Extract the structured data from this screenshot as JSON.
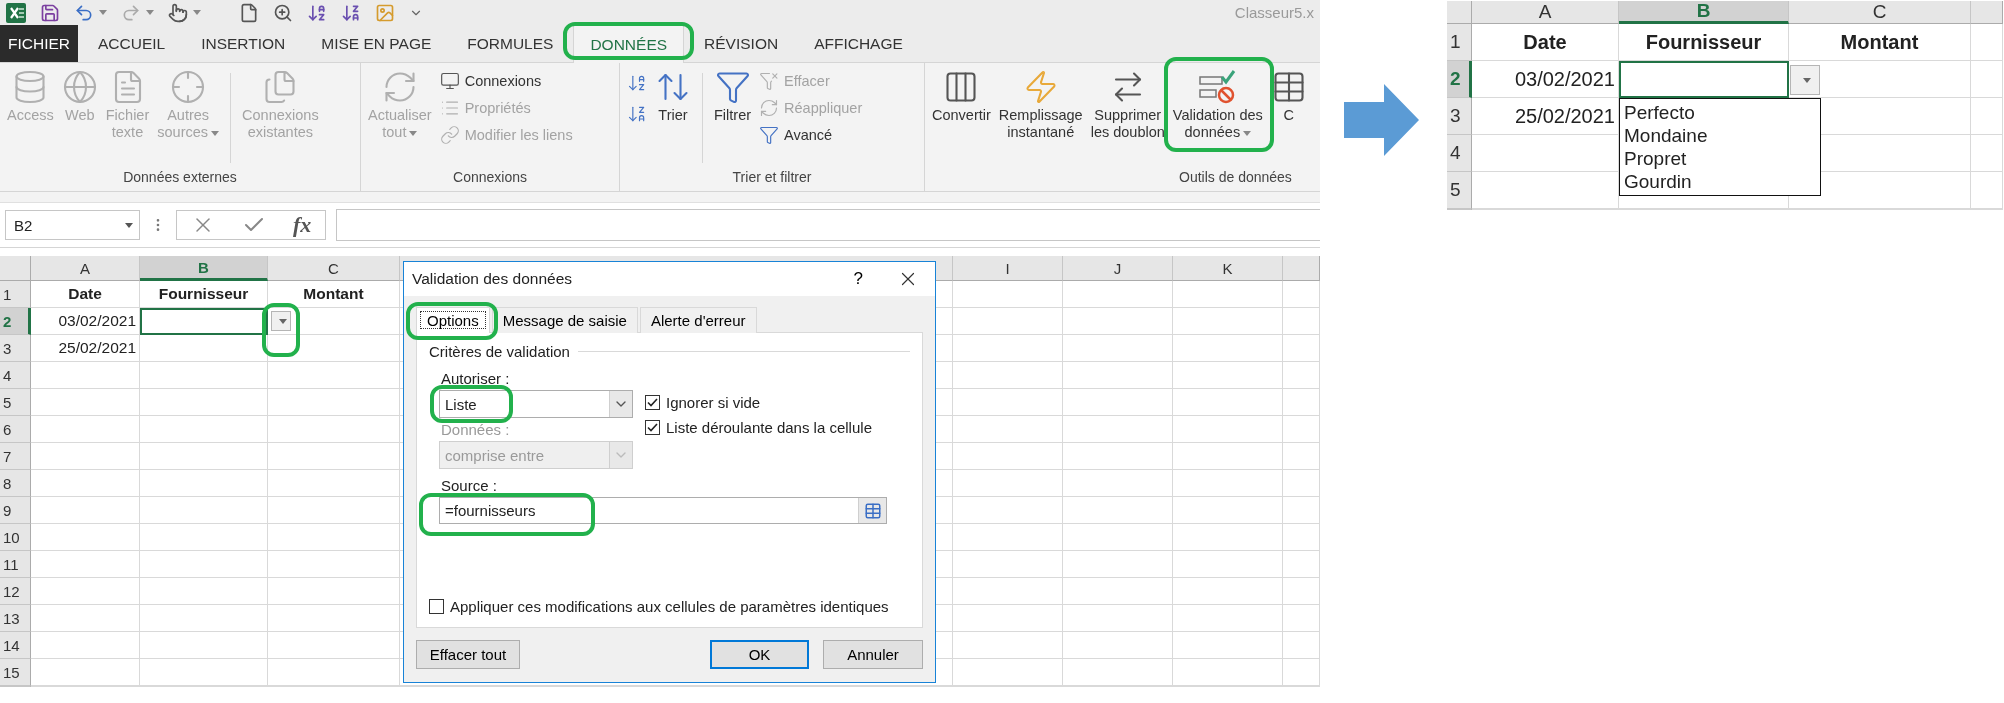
{
  "window": {
    "title": "Classeur5.x"
  },
  "tabs": [
    {
      "label": "FICHIER",
      "kind": "file",
      "selected": false,
      "annotated": false
    },
    {
      "label": "ACCUEIL",
      "kind": "tab",
      "selected": false,
      "annotated": false
    },
    {
      "label": "INSERTION",
      "kind": "tab",
      "selected": false,
      "annotated": false
    },
    {
      "label": "MISE EN PAGE",
      "kind": "tab",
      "selected": false,
      "annotated": false
    },
    {
      "label": "FORMULES",
      "kind": "tab",
      "selected": false,
      "annotated": false
    },
    {
      "label": "DONNÉES",
      "kind": "tab",
      "selected": true,
      "annotated": true
    },
    {
      "label": "RÉVISION",
      "kind": "tab",
      "selected": false,
      "annotated": false
    },
    {
      "label": "AFFICHAGE",
      "kind": "tab",
      "selected": false,
      "annotated": false
    }
  ],
  "ribbon": {
    "groups": [
      {
        "label": "Données externes",
        "items": [
          {
            "kind": "large",
            "label": "Access",
            "disabled": true,
            "dropdown": false
          },
          {
            "kind": "large",
            "label": "Web",
            "disabled": true,
            "dropdown": false
          },
          {
            "kind": "large",
            "label": "Fichier\ntexte",
            "disabled": true,
            "dropdown": false
          },
          {
            "kind": "large",
            "label": "Autres\nsources",
            "disabled": true,
            "dropdown": true
          },
          {
            "kind": "separator"
          },
          {
            "kind": "large",
            "label": "Connexions\nexistantes",
            "disabled": true,
            "dropdown": false
          }
        ]
      },
      {
        "label": "Connexions",
        "items": [
          {
            "kind": "large",
            "label": "Actualiser\ntout",
            "disabled": true,
            "dropdown": true
          },
          {
            "kind": "stack",
            "items": [
              {
                "kind": "small",
                "label": "Connexions",
                "disabled": false
              },
              {
                "kind": "small",
                "label": "Propriétés",
                "disabled": true
              },
              {
                "kind": "small",
                "label": "Modifier les liens",
                "disabled": true
              }
            ]
          }
        ]
      },
      {
        "label": "Trier et filtrer",
        "items": [
          {
            "kind": "stack",
            "items": [
              {
                "kind": "icon",
                "disabled": false
              },
              {
                "kind": "icon",
                "disabled": false
              }
            ]
          },
          {
            "kind": "large",
            "label": "Trier",
            "disabled": false,
            "dropdown": false
          },
          {
            "kind": "separator"
          },
          {
            "kind": "large",
            "label": "Filtrer",
            "disabled": false,
            "dropdown": false
          },
          {
            "kind": "stack",
            "items": [
              {
                "kind": "small",
                "label": "Effacer",
                "disabled": true
              },
              {
                "kind": "small",
                "label": "Réappliquer",
                "disabled": true
              },
              {
                "kind": "small",
                "label": "Avancé",
                "disabled": false
              }
            ]
          }
        ]
      },
      {
        "label": "Outils de données",
        "items": [
          {
            "kind": "large",
            "label": "Convertir",
            "disabled": false,
            "dropdown": false
          },
          {
            "kind": "large",
            "label": "Remplissage\ninstantané",
            "disabled": false,
            "dropdown": false
          },
          {
            "kind": "large",
            "label": "Supprimer\nles doublon",
            "disabled": false,
            "dropdown": false
          },
          {
            "kind": "large",
            "label": "Validation des\ndonnées",
            "disabled": false,
            "dropdown": true,
            "annotated": true
          },
          {
            "kind": "large",
            "label": "C",
            "disabled": false,
            "dropdown": false
          }
        ]
      }
    ]
  },
  "formula_bar": {
    "name_box": "B2",
    "function_label": "fx"
  },
  "sheet": {
    "columns": [
      {
        "label": "A",
        "selected": false
      },
      {
        "label": "B",
        "selected": true
      },
      {
        "label": "C",
        "selected": false
      },
      {
        "label": "I",
        "selected": false
      },
      {
        "label": "J",
        "selected": false
      },
      {
        "label": "K",
        "selected": false
      }
    ],
    "rows": [
      {
        "number": "1",
        "kind": "header",
        "selected": false,
        "cells": [
          "Date",
          "Fournisseur",
          "Montant"
        ]
      },
      {
        "number": "2",
        "kind": "data",
        "selected": true,
        "cells": [
          "03/02/2021"
        ]
      },
      {
        "number": "3",
        "kind": "data",
        "selected": false,
        "cells": [
          "25/02/2021"
        ]
      },
      {
        "number": "4",
        "kind": "data",
        "selected": false
      },
      {
        "number": "5",
        "kind": "data",
        "selected": false
      },
      {
        "number": "6",
        "kind": "data",
        "selected": false
      },
      {
        "number": "7",
        "kind": "data",
        "selected": false
      },
      {
        "number": "8",
        "kind": "data",
        "selected": false
      },
      {
        "number": "9",
        "kind": "data",
        "selected": false
      },
      {
        "number": "10",
        "kind": "data",
        "selected": false
      },
      {
        "number": "11",
        "kind": "data",
        "selected": false
      },
      {
        "number": "12",
        "kind": "data",
        "selected": false
      },
      {
        "number": "13",
        "kind": "data",
        "selected": false
      },
      {
        "number": "14",
        "kind": "data",
        "selected": false
      },
      {
        "number": "15",
        "kind": "data",
        "selected": false
      }
    ],
    "cell_dropdown": {
      "annotated": true
    }
  },
  "dialog": {
    "title": "Validation des données",
    "help": "?",
    "tabs": [
      {
        "label": "Options",
        "selected": true,
        "annotated": true
      },
      {
        "label": "Message de saisie",
        "selected": false,
        "annotated": false
      },
      {
        "label": "Alerte d'erreur",
        "selected": false,
        "annotated": false
      }
    ],
    "section": "Critères de validation",
    "allow": {
      "label": "Autoriser :",
      "value": "Liste",
      "annotated": true
    },
    "checkboxes": [
      {
        "label": "Ignorer si vide",
        "checked": true
      },
      {
        "label": "Liste déroulante dans la cellule",
        "checked": true
      }
    ],
    "data": {
      "label": "Données :",
      "value": "comprise entre",
      "disabled": true
    },
    "source": {
      "label": "Source :",
      "value": "=fournisseurs",
      "annotated": true
    },
    "apply_all": {
      "label": "Appliquer ces modifications aux cellules de paramètres identiques",
      "checked": false
    },
    "buttons": [
      {
        "label": "Effacer tout",
        "kind": "secondary"
      },
      {
        "label": "OK",
        "kind": "default"
      },
      {
        "label": "Annuler",
        "kind": "secondary"
      }
    ]
  },
  "zoom_view": {
    "columns": [
      {
        "label": "A",
        "selected": false
      },
      {
        "label": "B",
        "selected": true
      },
      {
        "label": "C",
        "selected": false
      }
    ],
    "rows": [
      {
        "number": "1",
        "kind": "header",
        "selected": false,
        "cells": [
          "Date",
          "Fournisseur",
          "Montant"
        ]
      },
      {
        "number": "2",
        "kind": "data",
        "selected": true,
        "cells": [
          "03/02/2021"
        ]
      },
      {
        "number": "3",
        "kind": "data",
        "selected": false,
        "cells": [
          "25/02/2021"
        ]
      },
      {
        "number": "4",
        "kind": "data",
        "selected": false
      },
      {
        "number": "5",
        "kind": "data",
        "selected": false
      }
    ],
    "list_items": [
      "Perfecto",
      "Mondaine",
      "Propret",
      "Gourdin"
    ]
  }
}
